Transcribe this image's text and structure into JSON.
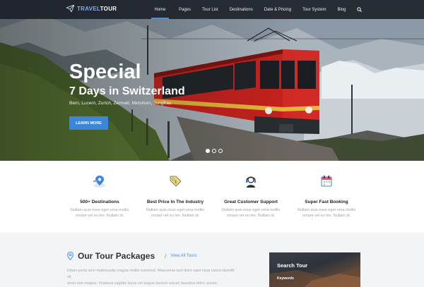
{
  "brand": {
    "part1": "TRAVEL",
    "part2": "TOUR"
  },
  "nav": {
    "items": [
      {
        "label": "Home",
        "active": true
      },
      {
        "label": "Pages"
      },
      {
        "label": "Tour List"
      },
      {
        "label": "Destinations"
      },
      {
        "label": "Date & Pricing"
      },
      {
        "label": "Tour System"
      },
      {
        "label": "Blog"
      }
    ],
    "search_icon": "search-icon"
  },
  "hero": {
    "title": "Special",
    "subtitle": "7 Days in Switzerland",
    "places": "Bern, Lucern, Zurich, Zermatt, Metshorn, Jungfrau",
    "button": "LEARN MORE",
    "slides_total": 3,
    "slide_active": 1
  },
  "features": [
    {
      "icon": "map-pin-icon",
      "title": "500+ Destinations",
      "text1": "Nullam quis risus eget urna mollis",
      "text2": "ornare vel eu leo. Nullam id."
    },
    {
      "icon": "price-tag-icon",
      "title": "Best Price In The Industry",
      "text1": "Nullam quis risus eget urna mollis",
      "text2": "ornare vel eu leo. Nullam id."
    },
    {
      "icon": "support-agent-icon",
      "title": "Great Customer Support",
      "text1": "Nullam quis risus eget urna mollis",
      "text2": "ornare vel eu leo. Nullam id."
    },
    {
      "icon": "calendar-icon",
      "title": "Super Fast Booking",
      "text1": "Nullam quis risus eget urna mollis",
      "text2": "ornare vel eu leo. Nullam id."
    }
  ],
  "packages": {
    "title": "Our Tour Packages",
    "separator": "/",
    "link": "View All Tours",
    "desc1": "Etiam porta sem malesuada magna mollis euismod. Maecenas sed diam eget risus varius blandit sit",
    "desc2": "amet non magna. Vivamus sagittis lacus vel augue laoreet rutrum faucibus dolor auctor."
  },
  "search": {
    "title": "Search Tour",
    "keywords_label": "Keywords"
  },
  "colors": {
    "accent": "#4a90e2",
    "nav_bg": "#191e26",
    "train_red": "#c8201d"
  }
}
